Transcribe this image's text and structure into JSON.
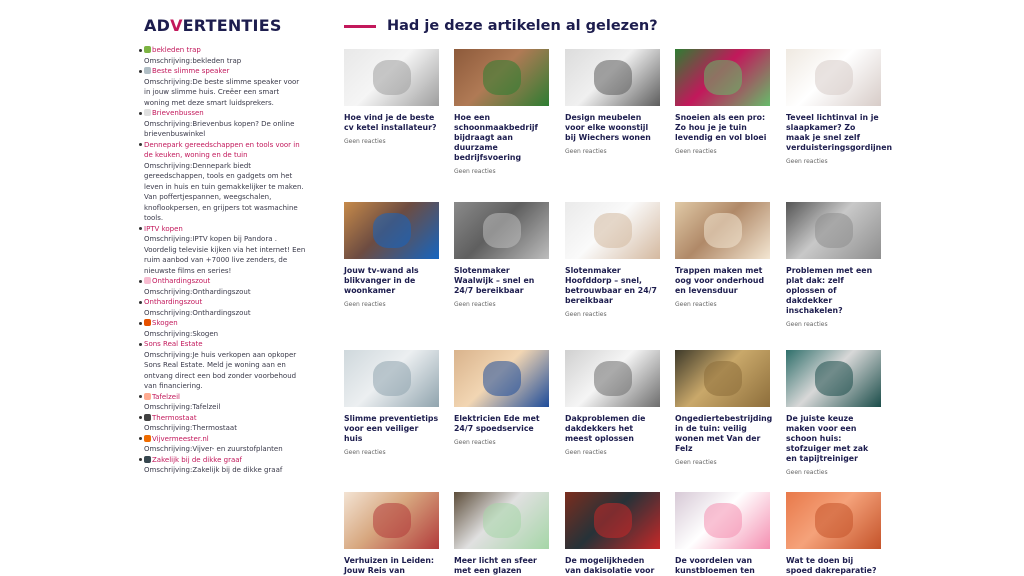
{
  "sidebar": {
    "title_pre": "AD",
    "title_accent": "V",
    "title_post": "ERTENTIES",
    "ads": [
      {
        "label": "bekleden trap",
        "desc": "Omschrijving:bekleden trap",
        "icon": "wifi-icon",
        "color": "#7cb342"
      },
      {
        "label": "Beste slimme speaker",
        "desc": "Omschrijving:De beste slimme speaker voor in jouw slimme huis. Creëer een smart woning met deze smart luidsprekers.",
        "icon": "speaker-icon",
        "color": "#b0bec5"
      },
      {
        "label": "Brievenbussen",
        "desc": "Omschrijving:Brievenbus kopen? De online brievenbuswinkel",
        "icon": "mailbox-icon",
        "color": "#e0e0e0"
      },
      {
        "label": "Dennepark gereedschappen en tools voor in de keuken, woning en de tuin",
        "desc": "Omschrijving:Dennepark biedt gereedschappen, tools en gadgets om het leven in huis en tuin gemakkelijker te maken. Van poffertjespannen, weegschalen, knoflookpersen, en grijpers tot wasmachine tools.",
        "icon": "",
        "color": ""
      },
      {
        "label": "IPTV kopen",
        "desc": "Omschrijving:IPTV kopen bij Pandora . Voordelig televisie kijken via het internet! Een ruim aanbod van +7000 live zenders, de nieuwste films en series!",
        "icon": "",
        "color": ""
      },
      {
        "label": "Onthardingszout",
        "desc": "Omschrijving:Onthardingszout",
        "icon": "salt-icon",
        "color": "#f8bbd0"
      },
      {
        "label": "Onthardingszout",
        "desc": "Omschrijving:Onthardingszout",
        "icon": "",
        "color": ""
      },
      {
        "label": "Skogen",
        "desc": "Omschrijving:Skogen",
        "icon": "skogen-icon",
        "color": "#e65100"
      },
      {
        "label": "Sons Real Estate",
        "desc": "Omschrijving:Je huis verkopen aan opkoper Sons Real Estate. Meld je woning aan en ontvang direct een bod zonder voorbehoud van financiering.",
        "icon": "",
        "color": ""
      },
      {
        "label": "Tafelzeil",
        "desc": "Omschrijving:Tafelzeil",
        "icon": "table-icon",
        "color": "#ffab91"
      },
      {
        "label": "Thermostaat",
        "desc": "Omschrijving:Thermostaat",
        "icon": "thermostat-icon",
        "color": "#424242"
      },
      {
        "label": "Vijvermeester.nl",
        "desc": "Omschrijving:Vijver- en zuurstofplanten",
        "icon": "pond-icon",
        "color": "#ef6c00"
      },
      {
        "label": "Zakelijk bij de dikke graaf",
        "desc": "Omschrijving:Zakelijk bij de dikke graaf",
        "icon": "person-icon",
        "color": "#37474f"
      }
    ]
  },
  "main": {
    "title": "Had je deze artikelen al gelezen?",
    "articles": [
      {
        "title": "Hoe vind je de beste cv ketel installateur?",
        "meta": "Geen reacties",
        "img": [
          "#e8e8e8",
          "#9e9e9e",
          "#f5f5f5"
        ]
      },
      {
        "title": "Hoe een schoonmaakbedrijf bijdraagt aan duurzame bedrijfsvoering",
        "meta": "Geen reacties",
        "img": [
          "#8d5a3b",
          "#2e7d32",
          "#b07a55"
        ]
      },
      {
        "title": "Design meubelen voor elke woonstijl bij Wiechers wonen",
        "meta": "Geen reacties",
        "img": [
          "#dcdcdc",
          "#5d5d5d",
          "#f0f0f0"
        ]
      },
      {
        "title": "Snoeien als een pro: Zo hou je je tuin levendig en vol bloei",
        "meta": "Geen reacties",
        "img": [
          "#2e7d32",
          "#66bb6a",
          "#c2185b"
        ]
      },
      {
        "title": "Teveel lichtinval in je slaapkamer? Zo maak je snel zelf verduisteringsgordijnen",
        "meta": "Geen reacties",
        "img": [
          "#efe9e1",
          "#d7ccc8",
          "#ffffff"
        ]
      },
      {
        "title": "Jouw tv-wand als blikvanger in de woonkamer",
        "meta": "Geen reacties",
        "img": [
          "#c68a4a",
          "#1565c0",
          "#6d4c41"
        ]
      },
      {
        "title": "Slotenmaker Waalwijk – snel en 24/7 bereikbaar",
        "meta": "Geen reacties",
        "img": [
          "#8a8a8a",
          "#bdbdbd",
          "#5f5f5f"
        ]
      },
      {
        "title": "Slotenmaker Hoofddorp – snel, betrouwbaar en 24/7 bereikbaar",
        "meta": "Geen reacties",
        "img": [
          "#eaeaea",
          "#d4b9a0",
          "#fafafa"
        ]
      },
      {
        "title": "Trappen maken met oog voor onderhoud en levensduur",
        "meta": "Geen reacties",
        "img": [
          "#e0c9a6",
          "#f3e6d2",
          "#b08968"
        ]
      },
      {
        "title": "Problemen met een plat dak: zelf oplossen of dakdekker inschakelen?",
        "meta": "Geen reacties",
        "img": [
          "#555555",
          "#8e8e8e",
          "#c8c8c8"
        ]
      },
      {
        "title": "Slimme preventietips voor een veiliger huis",
        "meta": "Geen reacties",
        "img": [
          "#cfd8dc",
          "#90a4ae",
          "#eceff1"
        ]
      },
      {
        "title": "Elektricien Ede met 24/7 spoedservice",
        "meta": "Geen reacties",
        "img": [
          "#d9b38c",
          "#1e4c9a",
          "#f2d6b3"
        ]
      },
      {
        "title": "Dakproblemen die dakdekkers het meest oplossen",
        "meta": "Geen reacties",
        "img": [
          "#d0d0d0",
          "#6d6d6d",
          "#f5f5f5"
        ]
      },
      {
        "title": "Ongediertebestrijding in de tuin: veilig wonen met Van der Felz",
        "meta": "Geen reacties",
        "img": [
          "#3e3a2a",
          "#8d6e3b",
          "#c9a86a"
        ]
      },
      {
        "title": "De juiste keuze maken voor een schoon huis: stofzuiger met zak en tapijtreiniger",
        "meta": "Geen reacties",
        "img": [
          "#2f6f6b",
          "#1b4d4a",
          "#d8d8d8"
        ]
      },
      {
        "title": "Verhuizen in Leiden: Jouw Reis van",
        "meta": "",
        "img": [
          "#f3e3d3",
          "#b23b3b",
          "#d7a77f"
        ]
      },
      {
        "title": "Meer licht en sfeer met een glazen tuinkamer",
        "meta": "",
        "img": [
          "#5d4d3a",
          "#a5d6a7",
          "#e0e0e0"
        ]
      },
      {
        "title": "De mogelijkheden van dakisolatie voor jouw",
        "meta": "",
        "img": [
          "#7b2d1e",
          "#c62828",
          "#263238"
        ]
      },
      {
        "title": "De voordelen van kunstbloemen ten",
        "meta": "",
        "img": [
          "#d7c9d6",
          "#f48fb1",
          "#ffffff"
        ]
      },
      {
        "title": "Wat te doen bij spoed dakreparatie?",
        "meta": "",
        "img": [
          "#e8794a",
          "#c4532a",
          "#f5a27a"
        ]
      }
    ]
  }
}
